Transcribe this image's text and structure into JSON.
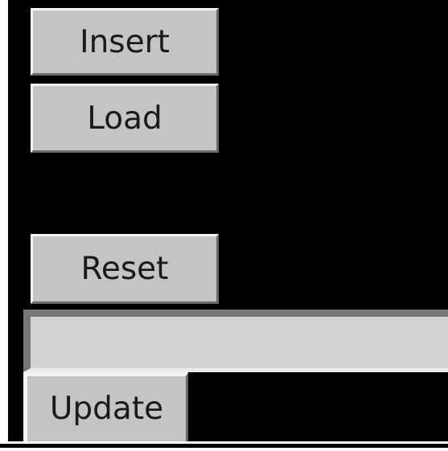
{
  "buttons": {
    "insert_label": "Insert",
    "load_label": "Load",
    "reset_label": "Reset",
    "update_label": "Update"
  },
  "entry": {
    "value": "",
    "placeholder": ""
  },
  "colors": {
    "panel_background": "#000000",
    "button_face": "#c4c4c4",
    "entry_background": "#d3d3d3",
    "text": "#1a1a1a"
  }
}
